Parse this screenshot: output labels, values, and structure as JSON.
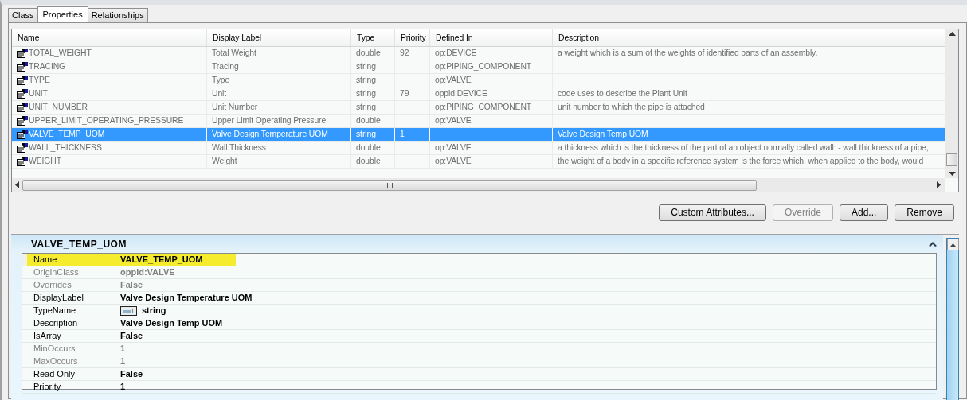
{
  "tabs": [
    {
      "label": "Class",
      "selected": false
    },
    {
      "label": "Properties",
      "selected": true
    },
    {
      "label": "Relationships",
      "selected": false
    }
  ],
  "grid": {
    "columns": [
      "Name",
      "Display Label",
      "Type",
      "Priority",
      "Defined In",
      "Description"
    ],
    "rows": [
      {
        "cells": [
          "TOTAL_WEIGHT",
          "Total Weight",
          "double",
          "92",
          "op:DEVICE",
          "a weight which is a sum of the weights of identified parts of an assembly."
        ],
        "selected": false
      },
      {
        "cells": [
          "TRACING",
          "Tracing",
          "string",
          "",
          "op:PIPING_COMPONENT",
          ""
        ],
        "selected": false
      },
      {
        "cells": [
          "TYPE",
          "Type",
          "string",
          "",
          "op:VALVE",
          ""
        ],
        "selected": false
      },
      {
        "cells": [
          "UNIT",
          "Unit",
          "string",
          "79",
          "oppid:DEVICE",
          "code uses to describe the Plant Unit"
        ],
        "selected": false
      },
      {
        "cells": [
          "UNIT_NUMBER",
          "Unit Number",
          "string",
          "",
          "op:PIPING_COMPONENT",
          "unit number to which the pipe is attached"
        ],
        "selected": false
      },
      {
        "cells": [
          "UPPER_LIMIT_OPERATING_PRESSURE",
          "Upper Limit Operating Pressure",
          "double",
          "",
          "op:VALVE",
          ""
        ],
        "selected": false
      },
      {
        "cells": [
          "VALVE_TEMP_UOM",
          "Valve Design Temperature UOM",
          "string",
          "1",
          "",
          "Valve Design Temp UOM"
        ],
        "selected": true
      },
      {
        "cells": [
          "WALL_THICKNESS",
          "Wall Thickness",
          "double",
          "",
          "op:VALVE",
          "a thickness which is the thickness of the part of an object normally called wall:  - wall thickness of a pipe,"
        ],
        "selected": false
      },
      {
        "cells": [
          "WEIGHT",
          "Weight",
          "double",
          "",
          "op:VALVE",
          "the weight of a body in a specific reference system is the force which, when applied to the body, would"
        ],
        "selected": false
      }
    ]
  },
  "buttons": [
    {
      "label": "Custom Attributes...",
      "disabled": false
    },
    {
      "label": "Override",
      "disabled": true
    },
    {
      "label": "Add...",
      "disabled": false
    },
    {
      "label": "Remove",
      "disabled": false
    }
  ],
  "details": {
    "title": "VALVE_TEMP_UOM",
    "properties": [
      {
        "label": "Name",
        "value": "VALVE_TEMP_UOM",
        "readonly": false,
        "highlighted": true,
        "kind": "text"
      },
      {
        "label": "OriginClass",
        "value": "oppid:VALVE",
        "readonly": true,
        "highlighted": false,
        "kind": "text"
      },
      {
        "label": "Overrides",
        "value": "False",
        "readonly": true,
        "highlighted": false,
        "kind": "text"
      },
      {
        "label": "DisplayLabel",
        "value": "Valve Design Temperature UOM",
        "readonly": false,
        "highlighted": false,
        "kind": "text"
      },
      {
        "label": "TypeName",
        "value": "string",
        "readonly": false,
        "highlighted": false,
        "kind": "type"
      },
      {
        "label": "Description",
        "value": "Valve Design Temp UOM",
        "readonly": false,
        "highlighted": false,
        "kind": "text"
      },
      {
        "label": "IsArray",
        "value": "False",
        "readonly": false,
        "highlighted": false,
        "kind": "text"
      },
      {
        "label": "MinOccurs",
        "value": "1",
        "readonly": true,
        "highlighted": false,
        "kind": "text"
      },
      {
        "label": "MaxOccurs",
        "value": "1",
        "readonly": true,
        "highlighted": false,
        "kind": "text"
      },
      {
        "label": "Read Only",
        "value": "False",
        "readonly": false,
        "highlighted": false,
        "kind": "text"
      },
      {
        "label": "Priority",
        "value": "1",
        "readonly": false,
        "highlighted": false,
        "kind": "text"
      }
    ]
  }
}
